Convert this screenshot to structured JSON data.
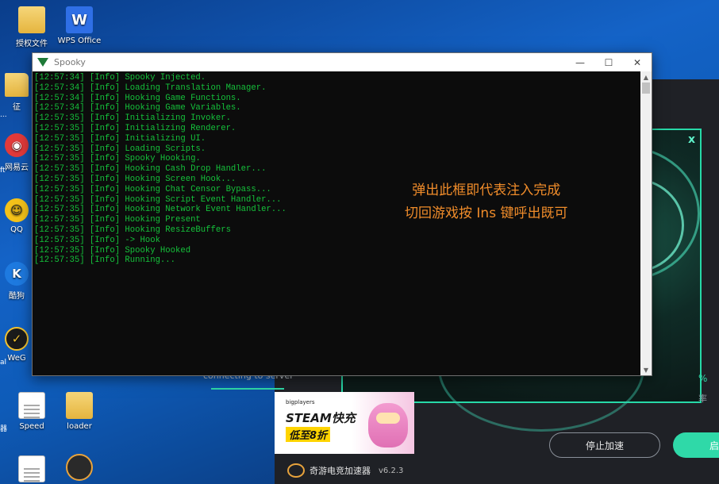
{
  "desktop": {
    "icons": [
      {
        "label": "授权文件"
      },
      {
        "label": "WPS Office"
      },
      {
        "label": "Speed"
      },
      {
        "label": "loader"
      }
    ],
    "left_labels": [
      "征",
      "网易云",
      "QQ",
      "酷狗",
      "WeG"
    ],
    "left_edge_labels": [
      "...",
      "ft",
      "al",
      "器"
    ]
  },
  "accelerator": {
    "status_text": "connecting to server",
    "percent_suffix": "%",
    "rate_label": "率",
    "banner": {
      "badge": "bigplayers",
      "headline": "STEAM快充",
      "promo": "低至8折"
    },
    "brand_name": "奇游电竞加速器",
    "version": "v6.2.3",
    "stop_button": "停止加速",
    "start_button": "启",
    "panel_close": "x",
    "colors": {
      "accent": "#2fd9a8"
    }
  },
  "console_window": {
    "title": "Spooky",
    "controls": {
      "minimize": "—",
      "maximize": "☐",
      "close": "✕"
    },
    "lines": [
      "[12:57:34] [Info] Spooky Injected.",
      "[12:57:34] [Info] Loading Translation Manager.",
      "[12:57:34] [Info] Hooking Game Functions.",
      "[12:57:34] [Info] Hooking Game Variables.",
      "[12:57:35] [Info] Initializing Invoker.",
      "[12:57:35] [Info] Initializing Renderer.",
      "[12:57:35] [Info] Initializing UI.",
      "[12:57:35] [Info] Loading Scripts.",
      "[12:57:35] [Info] Spooky Hooking.",
      "[12:57:35] [Info] Hooking Cash Drop Handler...",
      "[12:57:35] [Info] Hooking Screen Hook...",
      "[12:57:35] [Info] Hooking Chat Censor Bypass...",
      "[12:57:35] [Info] Hooking Script Event Handler...",
      "[12:57:35] [Info] Hooking Network Event Handler...",
      "[12:57:35] [Info] Hooking Present",
      "[12:57:35] [Info] Hooking ResizeBuffers",
      "[12:57:35] [Info] -> Hook",
      "[12:57:35] [Info] Spooky Hooked",
      "[12:57:35] [Info] Running..."
    ],
    "overlay_lines": [
      "弹出此框即代表注入完成",
      "切回游戏按 Ins 键呼出既可"
    ],
    "colors": {
      "console_text": "#15c23b",
      "overlay_text": "#f08c2a"
    }
  }
}
